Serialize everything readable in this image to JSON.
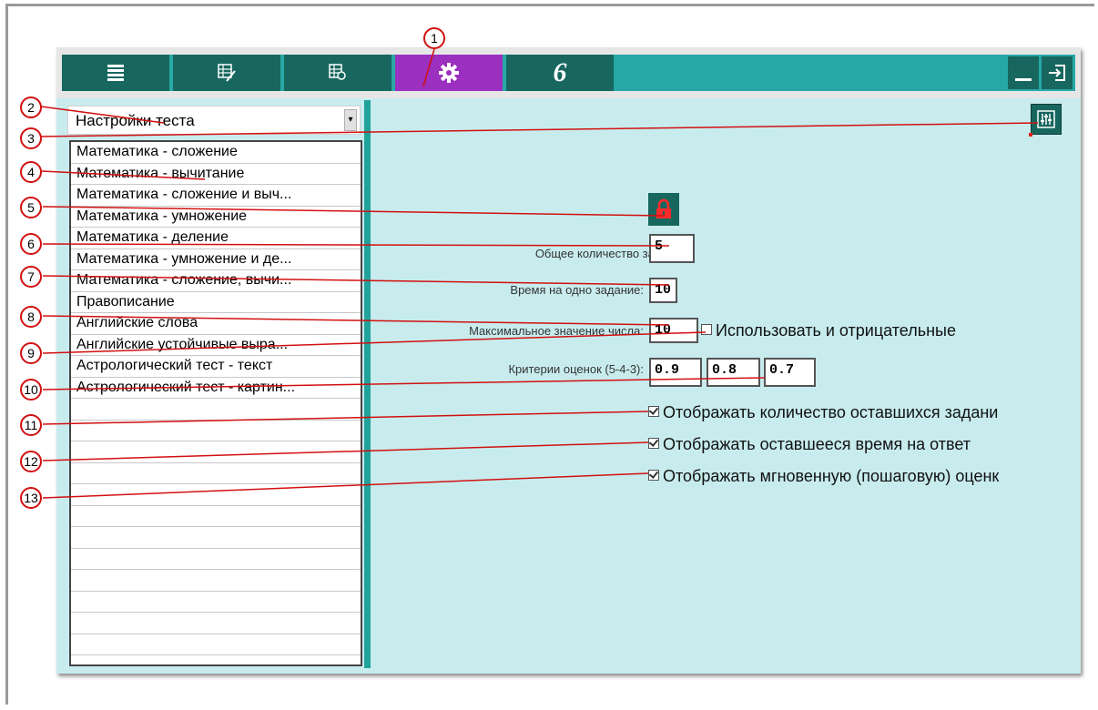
{
  "toolbar": {
    "tabs": [
      {
        "icon": "list-icon"
      },
      {
        "icon": "edit-table-icon"
      },
      {
        "icon": "table-search-icon"
      },
      {
        "icon": "gear-icon",
        "active": true
      },
      {
        "icon": "logo-6-icon",
        "text": "6"
      }
    ],
    "minimize_icon": "minimize-icon",
    "exit_icon": "exit-icon"
  },
  "colors": {
    "toolbar_bg": "#27a8a6",
    "button_bg": "#17675f",
    "active_bg": "#9b2fbf",
    "content_bg": "#c8ecee",
    "callout_red": "#d21010"
  },
  "left_panel": {
    "dropdown_value": "Настройки теста",
    "tests": [
      "Математика - сложение",
      "Математика - вычитание",
      "Математика - сложение и выч...",
      "Математика - умножение",
      "Математика - деление",
      "Математика - умножение и де...",
      "Математика - сложение, вычи...",
      "Правописание",
      "Английские слова",
      "Английские устойчивые выра...",
      "Астрологический тест - текст",
      "Астрологический тест - картин..."
    ]
  },
  "settings": {
    "total_tasks_label": "Общее количество заданий:",
    "total_tasks_value": "5",
    "time_per_task_label": "Время на одно задание:",
    "time_per_task_value": "10",
    "max_number_label": "Максимальное значение числа:",
    "max_number_value": "10",
    "negatives_label": "Использовать и отрицательные",
    "criteria_label": "Критерии оценок (5-4-3):",
    "criteria_values": [
      "0.9",
      "0.8",
      "0.7"
    ],
    "show_remaining_tasks": "Отображать количество оставшихся задани",
    "show_remaining_time": "Отображать оставшееся время на ответ",
    "show_instant_grade": "Отображать мгновенную (пошаговую) оценк"
  },
  "callouts": [
    "1",
    "2",
    "3",
    "4",
    "5",
    "6",
    "7",
    "8",
    "9",
    "10",
    "11",
    "12",
    "13"
  ]
}
